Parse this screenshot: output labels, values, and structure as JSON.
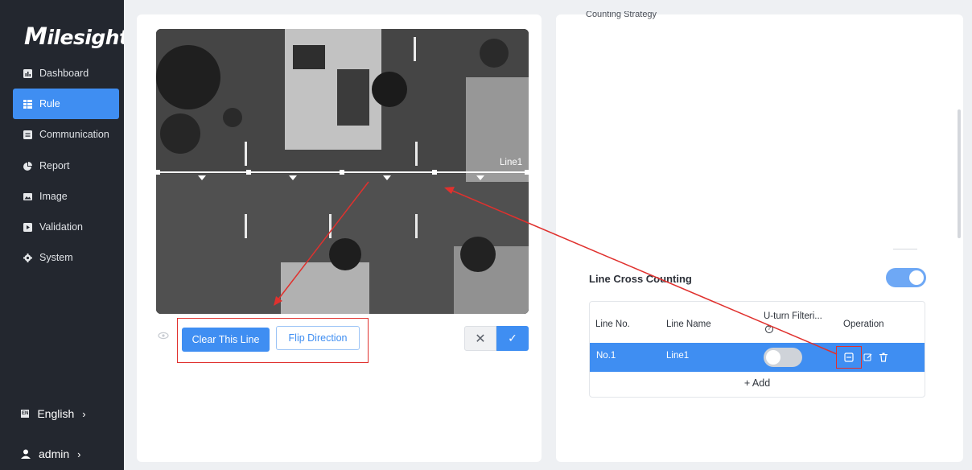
{
  "brand": {
    "logo_initial": "M",
    "logo_rest": "ilesight"
  },
  "sidebar": {
    "items": [
      {
        "label": "Dashboard",
        "icon": "bar-chart-icon"
      },
      {
        "label": "Rule",
        "icon": "rule-grid-icon",
        "active": true
      },
      {
        "label": "Communication",
        "icon": "message-icon"
      },
      {
        "label": "Report",
        "icon": "pie-chart-icon"
      },
      {
        "label": "Image",
        "icon": "image-icon"
      },
      {
        "label": "Validation",
        "icon": "validation-icon"
      },
      {
        "label": "System",
        "icon": "gear-icon"
      }
    ],
    "language": {
      "badge": "EN",
      "label": "English",
      "arrow": "›"
    },
    "user": {
      "label": "admin",
      "arrow": "›"
    }
  },
  "editor": {
    "line_label": "Line1",
    "clear_line_label": "Clear This Line",
    "flip_direction_label": "Flip Direction",
    "cancel_symbol": "✕",
    "confirm_symbol": "✓"
  },
  "right_panel": {
    "section_title_cut": "Counting Strategy",
    "line_cross": {
      "title": "Line Cross Counting",
      "enabled": true,
      "columns": [
        "Line No.",
        "Line Name",
        "U-turn Filteri...",
        "Operation"
      ],
      "rows": [
        {
          "no": "No.1",
          "name": "Line1",
          "uturn": false
        }
      ],
      "add_label": "+ Add"
    }
  },
  "colors": {
    "accent": "#3f8ef2",
    "sidebar": "#23272f",
    "annotation": "#e0312e"
  }
}
